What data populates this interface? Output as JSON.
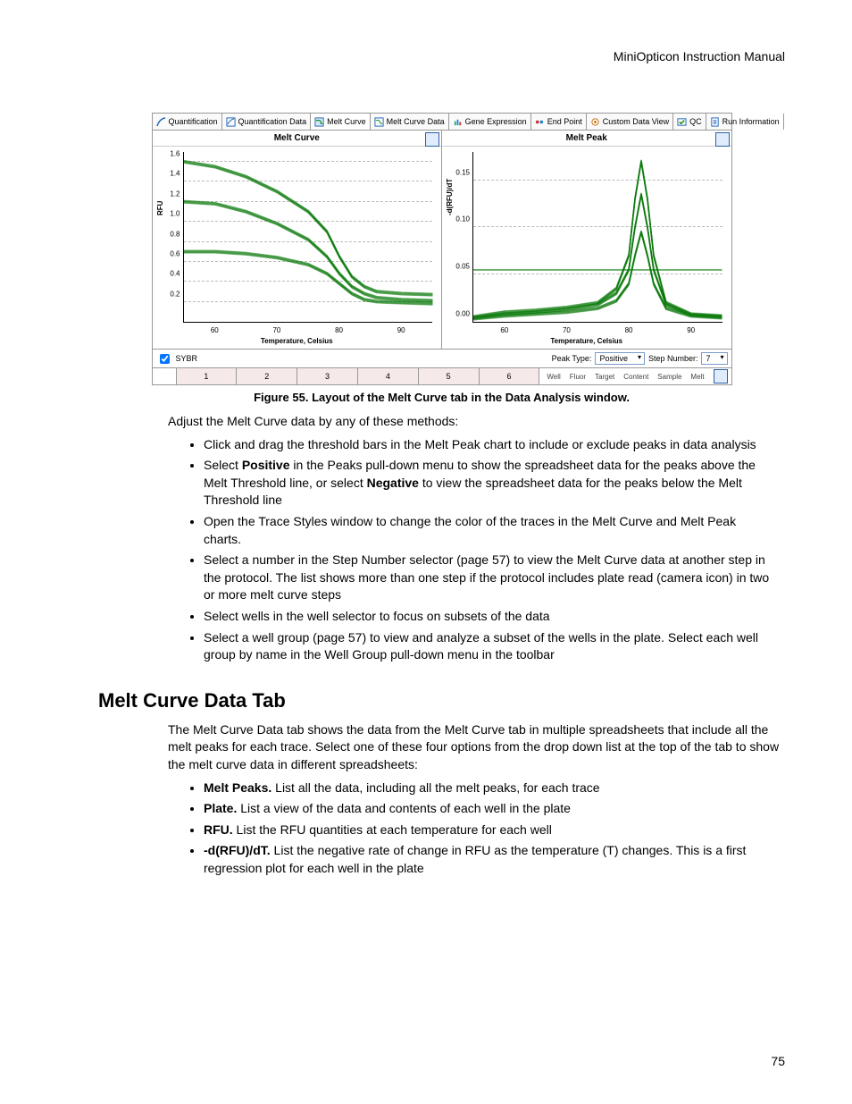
{
  "header": "MiniOpticon Instruction Manual",
  "page_number": "75",
  "figure": {
    "tabs": [
      "Quantification",
      "Quantification Data",
      "Melt Curve",
      "Melt Curve Data",
      "Gene Expression",
      "End Point",
      "Custom Data View",
      "QC",
      "Run Information"
    ],
    "active_tab_index": 2,
    "chart_left": {
      "title": "Melt Curve",
      "ylabel": "RFU",
      "xlabel": "Temperature, Celsius",
      "x_ticks": [
        "60",
        "70",
        "80",
        "90"
      ],
      "y_ticks": [
        "0.2",
        "0.4",
        "0.6",
        "0.8",
        "1.0",
        "1.2",
        "1.4",
        "1.6"
      ]
    },
    "chart_right": {
      "title": "Melt Peak",
      "ylabel": "-d(RFU)/dT",
      "xlabel": "Temperature, Celsius",
      "x_ticks": [
        "60",
        "70",
        "80",
        "90"
      ],
      "y_ticks": [
        "0.00",
        "0.05",
        "0.10",
        "0.15"
      ]
    },
    "legend": {
      "checkbox_label": "SYBR",
      "peak_type_label": "Peak Type:",
      "peak_type_value": "Positive",
      "step_number_label": "Step Number:",
      "step_number_value": "7"
    },
    "well_cols": [
      "1",
      "2",
      "3",
      "4",
      "5",
      "6"
    ],
    "bottom_tabs": [
      "Well",
      "Fluor",
      "Target",
      "Content",
      "Sample",
      "Melt"
    ]
  },
  "caption": "Figure 55. Layout of the Melt Curve tab in the Data Analysis window.",
  "intro1": "Adjust the Melt Curve data by any of these methods:",
  "list1": {
    "i0": "Click and drag the threshold bars in the Melt Peak chart to include or exclude peaks in data analysis",
    "i1_a": "Select ",
    "i1_b": "Positive",
    "i1_c": " in the Peaks pull-down menu to show the spreadsheet data for the peaks above the Melt Threshold line, or select ",
    "i1_d": "Negative",
    "i1_e": " to view the spreadsheet data for the peaks below the Melt Threshold line",
    "i2": "Open the Trace Styles window to change the color of the traces in the Melt Curve and Melt Peak charts.",
    "i3": "Select a number in the Step Number selector (page 57) to view the Melt Curve data at another step in the protocol. The list shows more than one step if the protocol includes plate read (camera icon) in two or more melt curve steps",
    "i4": "Select wells in the well selector to focus on subsets of the data",
    "i5": "Select a well group (page 57) to view and analyze a subset of the wells in the plate. Select each well group by name in the Well Group pull-down menu in the toolbar"
  },
  "section_title": "Melt Curve Data Tab",
  "intro2": "The Melt Curve Data tab shows the data from the Melt Curve tab in multiple spreadsheets that include all the melt peaks for each trace. Select one of these four options from the drop down list at the top of the tab to show the melt curve data in different spreadsheets:",
  "list2": {
    "i0_a": "Melt Peaks.",
    "i0_b": " List all the data, including all the melt peaks, for each trace",
    "i1_a": "Plate.",
    "i1_b": " List a view of the data and contents of each well in the plate",
    "i2_a": "RFU.",
    "i2_b": " List the RFU quantities at each temperature for each well",
    "i3_a": "-d(RFU)/dT.",
    "i3_b": " List the negative rate of change in RFU as the temperature (T) changes. This is a first regression plot for each well in the plate"
  },
  "chart_data": [
    {
      "type": "line",
      "title": "Melt Curve",
      "xlabel": "Temperature, Celsius",
      "ylabel": "RFU",
      "xlim": [
        55,
        95
      ],
      "ylim": [
        0,
        1.7
      ],
      "series": [
        {
          "name": "trace-high",
          "x": [
            55,
            60,
            65,
            70,
            75,
            78,
            80,
            82,
            84,
            86,
            90,
            95
          ],
          "y": [
            1.6,
            1.55,
            1.45,
            1.3,
            1.1,
            0.9,
            0.65,
            0.45,
            0.35,
            0.3,
            0.28,
            0.27
          ]
        },
        {
          "name": "trace-mid",
          "x": [
            55,
            60,
            65,
            70,
            75,
            78,
            80,
            82,
            84,
            86,
            90,
            95
          ],
          "y": [
            1.2,
            1.18,
            1.1,
            0.98,
            0.82,
            0.65,
            0.48,
            0.35,
            0.28,
            0.24,
            0.22,
            0.21
          ]
        },
        {
          "name": "trace-low",
          "x": [
            55,
            60,
            65,
            70,
            75,
            78,
            80,
            82,
            84,
            86,
            90,
            95
          ],
          "y": [
            0.7,
            0.7,
            0.68,
            0.64,
            0.57,
            0.48,
            0.38,
            0.28,
            0.22,
            0.2,
            0.19,
            0.18
          ]
        }
      ]
    },
    {
      "type": "line",
      "title": "Melt Peak",
      "xlabel": "Temperature, Celsius",
      "ylabel": "-d(RFU)/dT",
      "xlim": [
        55,
        95
      ],
      "ylim": [
        0,
        0.18
      ],
      "threshold": 0.055,
      "series": [
        {
          "name": "peak-high",
          "x": [
            55,
            60,
            65,
            70,
            75,
            78,
            80,
            81,
            82,
            83,
            84,
            86,
            90,
            95
          ],
          "y": [
            0.005,
            0.01,
            0.012,
            0.015,
            0.02,
            0.035,
            0.07,
            0.13,
            0.17,
            0.13,
            0.07,
            0.02,
            0.008,
            0.006
          ]
        },
        {
          "name": "peak-mid",
          "x": [
            55,
            60,
            65,
            70,
            75,
            78,
            80,
            81,
            82,
            83,
            84,
            86,
            90,
            95
          ],
          "y": [
            0.004,
            0.008,
            0.01,
            0.013,
            0.018,
            0.03,
            0.055,
            0.1,
            0.135,
            0.1,
            0.055,
            0.018,
            0.007,
            0.005
          ]
        },
        {
          "name": "peak-low",
          "x": [
            55,
            60,
            65,
            70,
            75,
            78,
            80,
            81,
            82,
            83,
            84,
            86,
            90,
            95
          ],
          "y": [
            0.003,
            0.006,
            0.008,
            0.01,
            0.014,
            0.022,
            0.04,
            0.07,
            0.095,
            0.07,
            0.04,
            0.014,
            0.006,
            0.004
          ]
        }
      ]
    }
  ]
}
